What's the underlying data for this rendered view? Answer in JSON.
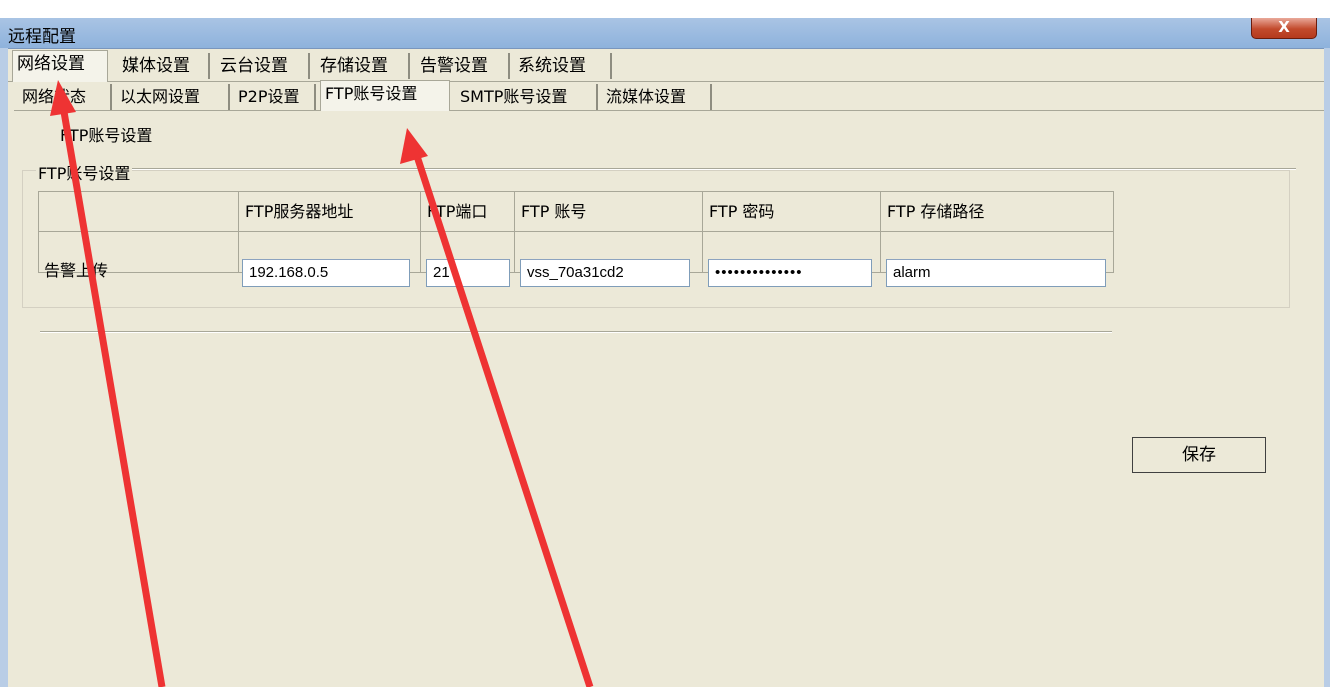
{
  "window": {
    "title": "远程配置",
    "close_glyph": "X"
  },
  "main_tabs": [
    {
      "label": "网络设置",
      "active": true
    },
    {
      "label": "媒体设置",
      "active": false
    },
    {
      "label": "云台设置",
      "active": false
    },
    {
      "label": "存储设置",
      "active": false
    },
    {
      "label": "告警设置",
      "active": false
    },
    {
      "label": "系统设置",
      "active": false
    }
  ],
  "sub_tabs": [
    {
      "label": "网络状态",
      "active": false
    },
    {
      "label": "以太网设置",
      "active": false
    },
    {
      "label": "P2P设置",
      "active": false
    },
    {
      "label": "FTP账号设置",
      "active": true
    },
    {
      "label": "SMTP账号设置",
      "active": false
    },
    {
      "label": "流媒体设置",
      "active": false
    }
  ],
  "panel": {
    "title": "FTP账号设置",
    "group_title": "FTP账号设置",
    "columns": [
      "",
      "FTP服务器地址",
      "FTP端口",
      "FTP 账号",
      "FTP 密码",
      "FTP 存储路径"
    ],
    "row": {
      "label": "告警上传",
      "server": "192.168.0.5",
      "port": "21",
      "account": "vss_70a31cd2",
      "password_masked": "••••••••••••••",
      "path": "alarm"
    }
  },
  "save_label": "保存",
  "annotation": {
    "arrow_color": "#ee3333"
  }
}
